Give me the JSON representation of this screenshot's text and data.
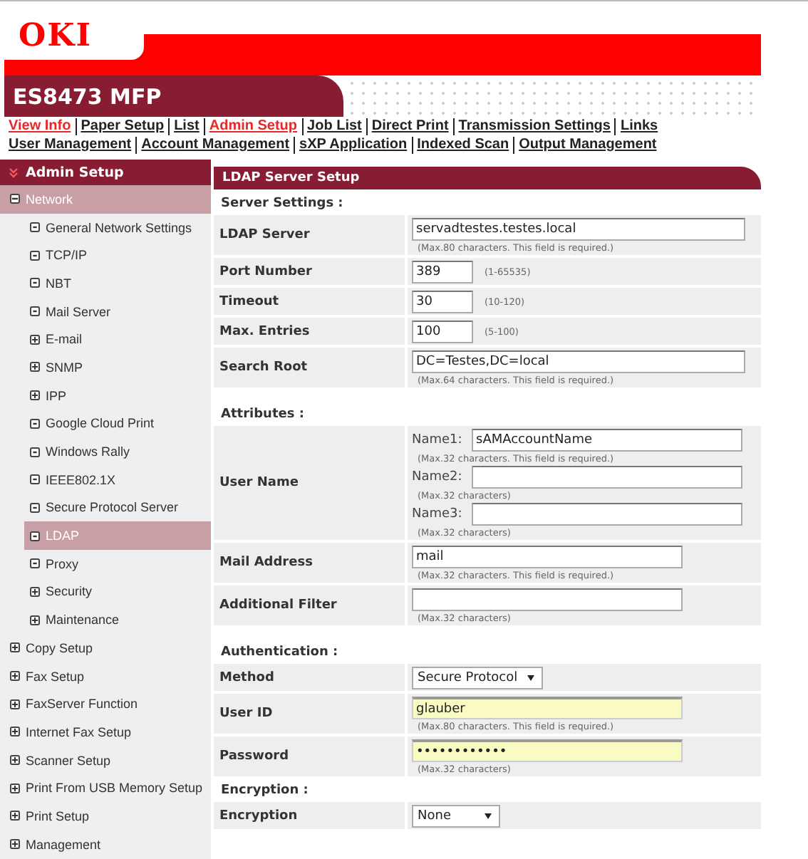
{
  "logo": "OKI",
  "model": "ES8473 MFP",
  "nav": {
    "main_links": [
      {
        "label": "View Info",
        "selected": true
      },
      {
        "label": "Paper Setup",
        "selected": false
      },
      {
        "label": "List",
        "selected": false
      },
      {
        "label": "Admin Setup",
        "selected": true
      },
      {
        "label": "Job List",
        "selected": false
      },
      {
        "label": "Direct Print",
        "selected": false
      },
      {
        "label": "Transmission Settings",
        "selected": false
      },
      {
        "label": "Links",
        "selected": false
      }
    ],
    "sub_links": [
      {
        "label": "User Management",
        "selected": false
      },
      {
        "label": "Account Management",
        "selected": false
      },
      {
        "label": "sXP Application",
        "selected": false
      },
      {
        "label": "Indexed Scan",
        "selected": false
      },
      {
        "label": "Output Management",
        "selected": false
      }
    ]
  },
  "sidebar": {
    "title": "Admin Setup",
    "items": [
      {
        "label": "Network",
        "kind": "group",
        "expanded": true,
        "selected": true,
        "children": [
          {
            "label": "General Network Settings",
            "kind": "page",
            "selected": false
          },
          {
            "label": "TCP/IP",
            "kind": "page",
            "selected": false
          },
          {
            "label": "NBT",
            "kind": "page",
            "selected": false
          },
          {
            "label": "Mail Server",
            "kind": "page",
            "selected": false
          },
          {
            "label": "E-mail",
            "kind": "group",
            "expanded": false,
            "selected": false
          },
          {
            "label": "SNMP",
            "kind": "group",
            "expanded": false,
            "selected": false
          },
          {
            "label": "IPP",
            "kind": "group",
            "expanded": false,
            "selected": false
          },
          {
            "label": "Google Cloud Print",
            "kind": "page",
            "selected": false
          },
          {
            "label": "Windows Rally",
            "kind": "page",
            "selected": false
          },
          {
            "label": "IEEE802.1X",
            "kind": "page",
            "selected": false
          },
          {
            "label": "Secure Protocol Server",
            "kind": "page",
            "selected": false
          },
          {
            "label": "LDAP",
            "kind": "page",
            "selected": true
          },
          {
            "label": "Proxy",
            "kind": "page",
            "selected": false
          },
          {
            "label": "Security",
            "kind": "group",
            "expanded": false,
            "selected": false
          },
          {
            "label": "Maintenance",
            "kind": "group",
            "expanded": false,
            "selected": false
          }
        ]
      },
      {
        "label": "Copy Setup",
        "kind": "group",
        "expanded": false,
        "selected": false
      },
      {
        "label": "Fax Setup",
        "kind": "group",
        "expanded": false,
        "selected": false
      },
      {
        "label": "FaxServer Function",
        "kind": "group",
        "expanded": false,
        "selected": false
      },
      {
        "label": "Internet Fax Setup",
        "kind": "group",
        "expanded": false,
        "selected": false
      },
      {
        "label": "Scanner Setup",
        "kind": "group",
        "expanded": false,
        "selected": false
      },
      {
        "label": "Print From USB Memory Setup",
        "kind": "group",
        "expanded": false,
        "selected": false
      },
      {
        "label": "Print Setup",
        "kind": "group",
        "expanded": false,
        "selected": false
      },
      {
        "label": "Management",
        "kind": "group",
        "expanded": false,
        "selected": false
      }
    ]
  },
  "panel": {
    "title": "LDAP Server Setup",
    "sections": [
      {
        "title": "Server Settings :",
        "rows": [
          {
            "label": "LDAP Server",
            "kind": "wide",
            "value": "servadtestes.testes.local",
            "hint": "(Max.80 characters. This field is required.)",
            "autofill": false
          },
          {
            "label": "Port Number",
            "kind": "number",
            "value": "389",
            "hint": "(1-65535)",
            "autofill": false
          },
          {
            "label": "Timeout",
            "kind": "number",
            "value": "30",
            "hint": "(10-120)",
            "autofill": false
          },
          {
            "label": "Max. Entries",
            "kind": "number",
            "value": "100",
            "hint": "(5-100)",
            "autofill": false
          },
          {
            "label": "Search Root",
            "kind": "wide",
            "value": "DC=Testes,DC=local",
            "hint": "(Max.64 characters. This field is required.)",
            "autofill": false
          }
        ]
      },
      {
        "title": "Attributes :",
        "rows": [
          {
            "label": "User Name",
            "kind": "multi",
            "fields": [
              {
                "label": "Name1:",
                "value": "sAMAccountName",
                "hint": "(Max.32 characters. This field is required.)"
              },
              {
                "label": "Name2:",
                "hint": "(Max.32 characters)"
              },
              {
                "label": "Name3:",
                "hint": "(Max.32 characters)"
              }
            ]
          },
          {
            "label": "Mail Address",
            "kind": "text",
            "value": "mail",
            "hint": "(Max.32 characters. This field is required.)",
            "autofill": false
          },
          {
            "label": "Additional Filter",
            "kind": "text",
            "hint": "(Max.32 characters)",
            "autofill": false
          }
        ]
      },
      {
        "title": "Authentication :",
        "rows": [
          {
            "label": "Method",
            "kind": "select",
            "value": "Secure Protocol"
          },
          {
            "label": "User ID",
            "kind": "text",
            "value": "glauber",
            "hint": "(Max.80 characters. This field is required.)",
            "autofill": true
          },
          {
            "label": "Password",
            "kind": "password",
            "value": "••••••••••••",
            "hint": "(Max.32 characters)",
            "autofill": true
          }
        ]
      },
      {
        "title": "Encryption :",
        "rows": [
          {
            "label": "Encryption",
            "kind": "select",
            "value": "None"
          }
        ]
      }
    ]
  }
}
